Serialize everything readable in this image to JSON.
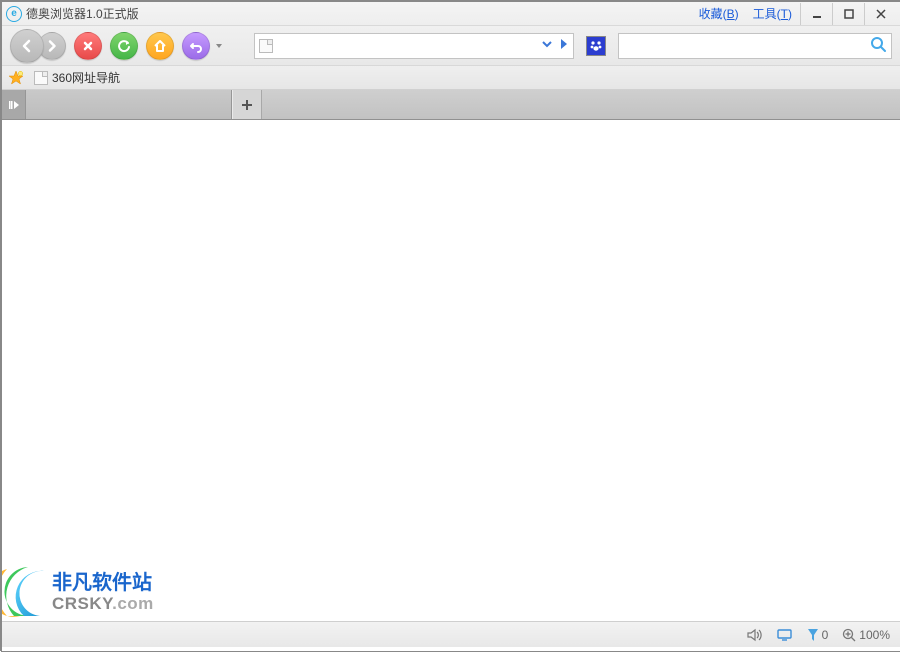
{
  "window": {
    "title": "德奥浏览器1.0正式版"
  },
  "menus": {
    "favorites_label": "收藏",
    "favorites_key": "B",
    "tools_label": "工具",
    "tools_key": "T"
  },
  "address": {
    "value": "",
    "placeholder": ""
  },
  "search": {
    "value": "",
    "placeholder": ""
  },
  "bookmarks": {
    "items": [
      {
        "label": "360网址导航"
      }
    ]
  },
  "status": {
    "block_count": "0",
    "zoom": "100%"
  },
  "watermark": {
    "line1": "非凡软件站",
    "line2": "CRSKY.com"
  },
  "colors": {
    "accent_blue": "#3b77d8",
    "search_icon": "#44a9ea"
  }
}
